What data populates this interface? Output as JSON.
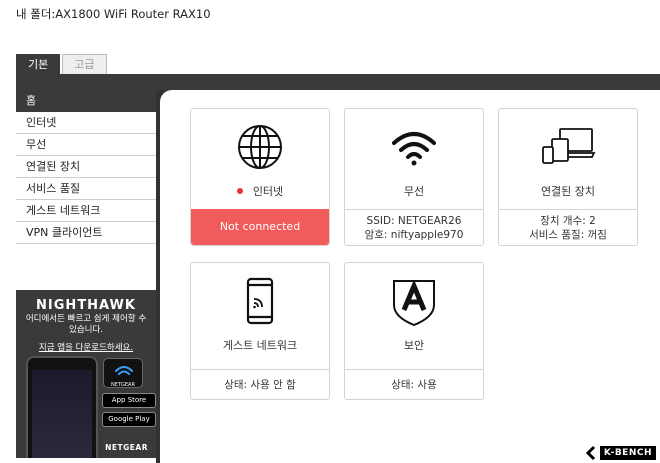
{
  "header": {
    "title": "내 폴더:AX1800 WiFi Router RAX10"
  },
  "tabs": [
    {
      "label": "기본",
      "active": true
    },
    {
      "label": "고급",
      "active": false
    }
  ],
  "sidebar": {
    "items": [
      {
        "label": "홈"
      },
      {
        "label": "인터넷"
      },
      {
        "label": "무선"
      },
      {
        "label": "연결된 장치"
      },
      {
        "label": "서비스 품질"
      },
      {
        "label": "게스트 네트워크"
      },
      {
        "label": "VPN 클라이언트"
      }
    ]
  },
  "cards": {
    "internet": {
      "label": "인터넷",
      "status": "Not connected",
      "icon": "globe-icon"
    },
    "wireless": {
      "label": "무선",
      "line1": "SSID: NETGEAR26",
      "line2": "암호: niftyapple970",
      "icon": "wifi-icon"
    },
    "devices": {
      "label": "연결된 장치",
      "line1": "장치 개수: 2",
      "line2": "서비스 품질: 꺼짐",
      "icon": "devices-icon"
    },
    "guest": {
      "label": "게스트 네트워크",
      "status": "상태: 사용 안 함",
      "icon": "phone-wifi-icon"
    },
    "security": {
      "label": "보안",
      "status": "상태: 사용",
      "icon": "shield-icon"
    }
  },
  "ad": {
    "brand": "NIGHTHAWK",
    "desc": "어디에서든 빠르고 쉽게 제어할 수 있습니다.",
    "download": "지금 앱을 다운로드하세요.",
    "app_store": "App Store",
    "google_play": "Google Play",
    "netgear": "NETGEAR",
    "app_icon_text": "NETGEAR"
  },
  "watermark": {
    "text": "K-BENCH"
  },
  "colors": {
    "error": "#f25b5b",
    "dark": "#3a3a3a",
    "dot": "#e33333"
  }
}
